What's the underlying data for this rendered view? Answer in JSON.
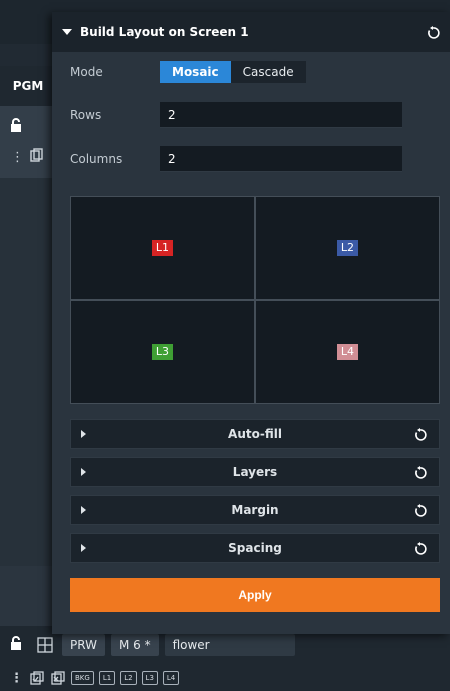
{
  "app": {
    "pgm_label": "PGM"
  },
  "panel": {
    "title": "Build Layout on Screen 1",
    "mode_label": "Mode",
    "mode_options": [
      "Mosaic",
      "Cascade"
    ],
    "mode_selected": "Mosaic",
    "rows_label": "Rows",
    "rows_value": "2",
    "columns_label": "Columns",
    "columns_value": "2",
    "grid_cells": [
      {
        "label": "L1",
        "color": "#d62424"
      },
      {
        "label": "L2",
        "color": "#3b5aa6"
      },
      {
        "label": "L3",
        "color": "#3f9f34"
      },
      {
        "label": "L4",
        "color": "#d18e95"
      }
    ],
    "sections": [
      "Auto-fill",
      "Layers",
      "Margin",
      "Spacing"
    ],
    "apply_label": "Apply"
  },
  "bottom_bar": {
    "prw_label": "PRW",
    "mode_chip": "M 6 *",
    "layout_name": "flower",
    "tags": [
      "BKG",
      "L1",
      "L2",
      "L3",
      "L4"
    ]
  },
  "colors": {
    "accent": "#2b87d8",
    "apply": "#f07820",
    "panel_bg": "#2a343e",
    "header_bg": "#1b232b"
  },
  "icons": {
    "reset": "reset-icon",
    "lock": "lock-icon",
    "layout": "layout-grid-icon",
    "copy": "copy-icon",
    "kebab": "kebab-icon"
  }
}
